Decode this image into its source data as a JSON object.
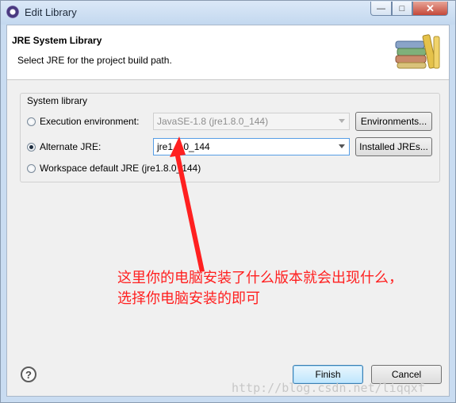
{
  "window": {
    "title": "Edit Library"
  },
  "header": {
    "title": "JRE System Library",
    "description": "Select JRE for the project build path."
  },
  "group": {
    "label": "System library",
    "execution_environment": {
      "label": "Execution environment:",
      "value": "JavaSE-1.8 (jre1.8.0_144)",
      "button": "Environments...",
      "checked": false
    },
    "alternate_jre": {
      "label": "Alternate JRE:",
      "value": "jre1.8.0_144",
      "button": "Installed JREs...",
      "checked": true
    },
    "workspace_default": {
      "label": "Workspace default JRE (jre1.8.0_144)",
      "checked": false
    }
  },
  "annotation": {
    "line1": "这里你的电脑安装了什么版本就会出现什么，",
    "line2": "选择你电脑安装的即可",
    "color": "#ff2020"
  },
  "footer": {
    "help": "?",
    "finish": "Finish",
    "cancel": "Cancel"
  },
  "watermark": "http://blog.csdn.net/liqqxf",
  "icons": {
    "app": "eclipse-icon",
    "header": "books-icon",
    "help": "help-icon"
  }
}
